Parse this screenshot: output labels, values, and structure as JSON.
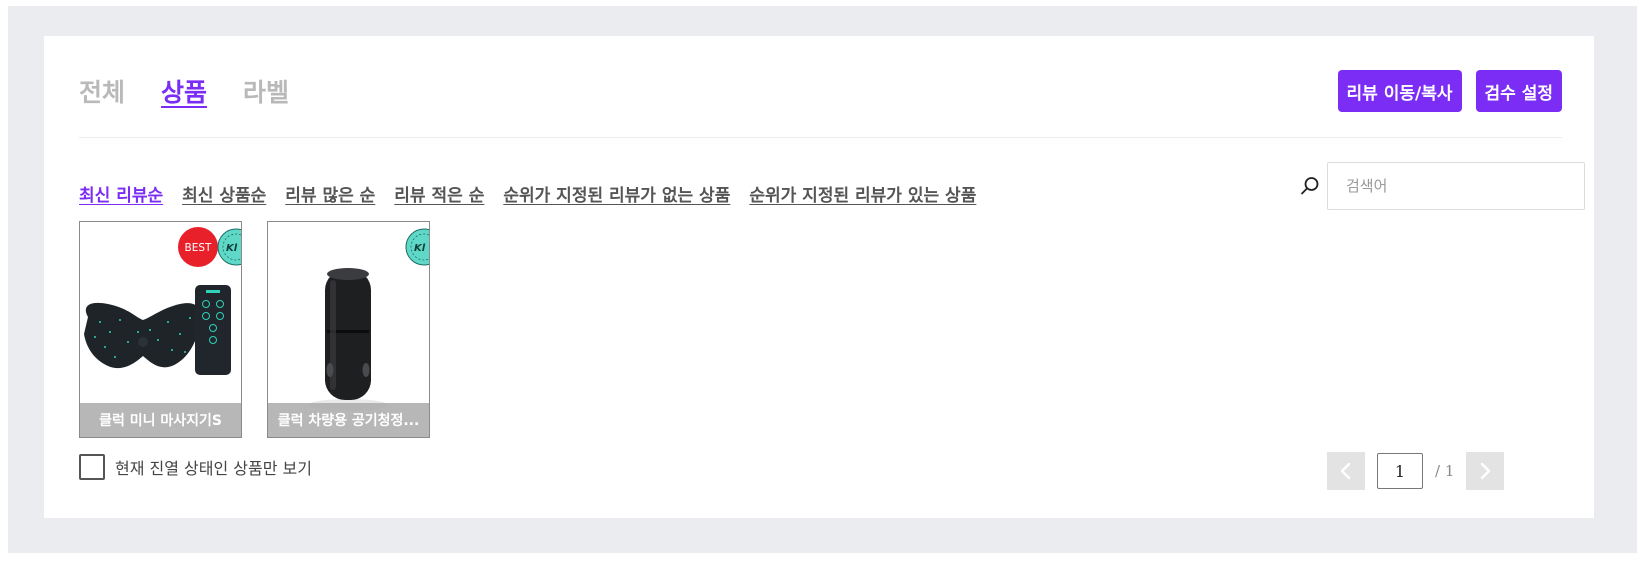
{
  "tabs": [
    {
      "label": "전체",
      "active": false
    },
    {
      "label": "상품",
      "active": true
    },
    {
      "label": "라벨",
      "active": false
    }
  ],
  "actions": {
    "move_copy_label": "리뷰 이동/복사",
    "review_settings_label": "검수 설정"
  },
  "sort_options": [
    {
      "label": "최신 리뷰순",
      "active": true
    },
    {
      "label": "최신 상품순",
      "active": false
    },
    {
      "label": "리뷰 많은 순",
      "active": false
    },
    {
      "label": "리뷰 적은 순",
      "active": false
    },
    {
      "label": "순위가 지정된 리뷰가 없는 상품",
      "active": false
    },
    {
      "label": "순위가 지정된 리뷰가 있는 상품",
      "active": false
    }
  ],
  "search": {
    "placeholder": "검색어",
    "value": ""
  },
  "products": [
    {
      "name": "클럭 미니 마사지기S",
      "badge": "BEST"
    },
    {
      "name": "클럭 차량용 공기청정..."
    }
  ],
  "filter": {
    "label": "현재 진열 상태인 상품만 보기",
    "checked": false
  },
  "pagination": {
    "current": "1",
    "total": "/ 1"
  },
  "colors": {
    "accent": "#7b2cf5",
    "background": "#ebecf0",
    "badge": "#e8202a"
  }
}
